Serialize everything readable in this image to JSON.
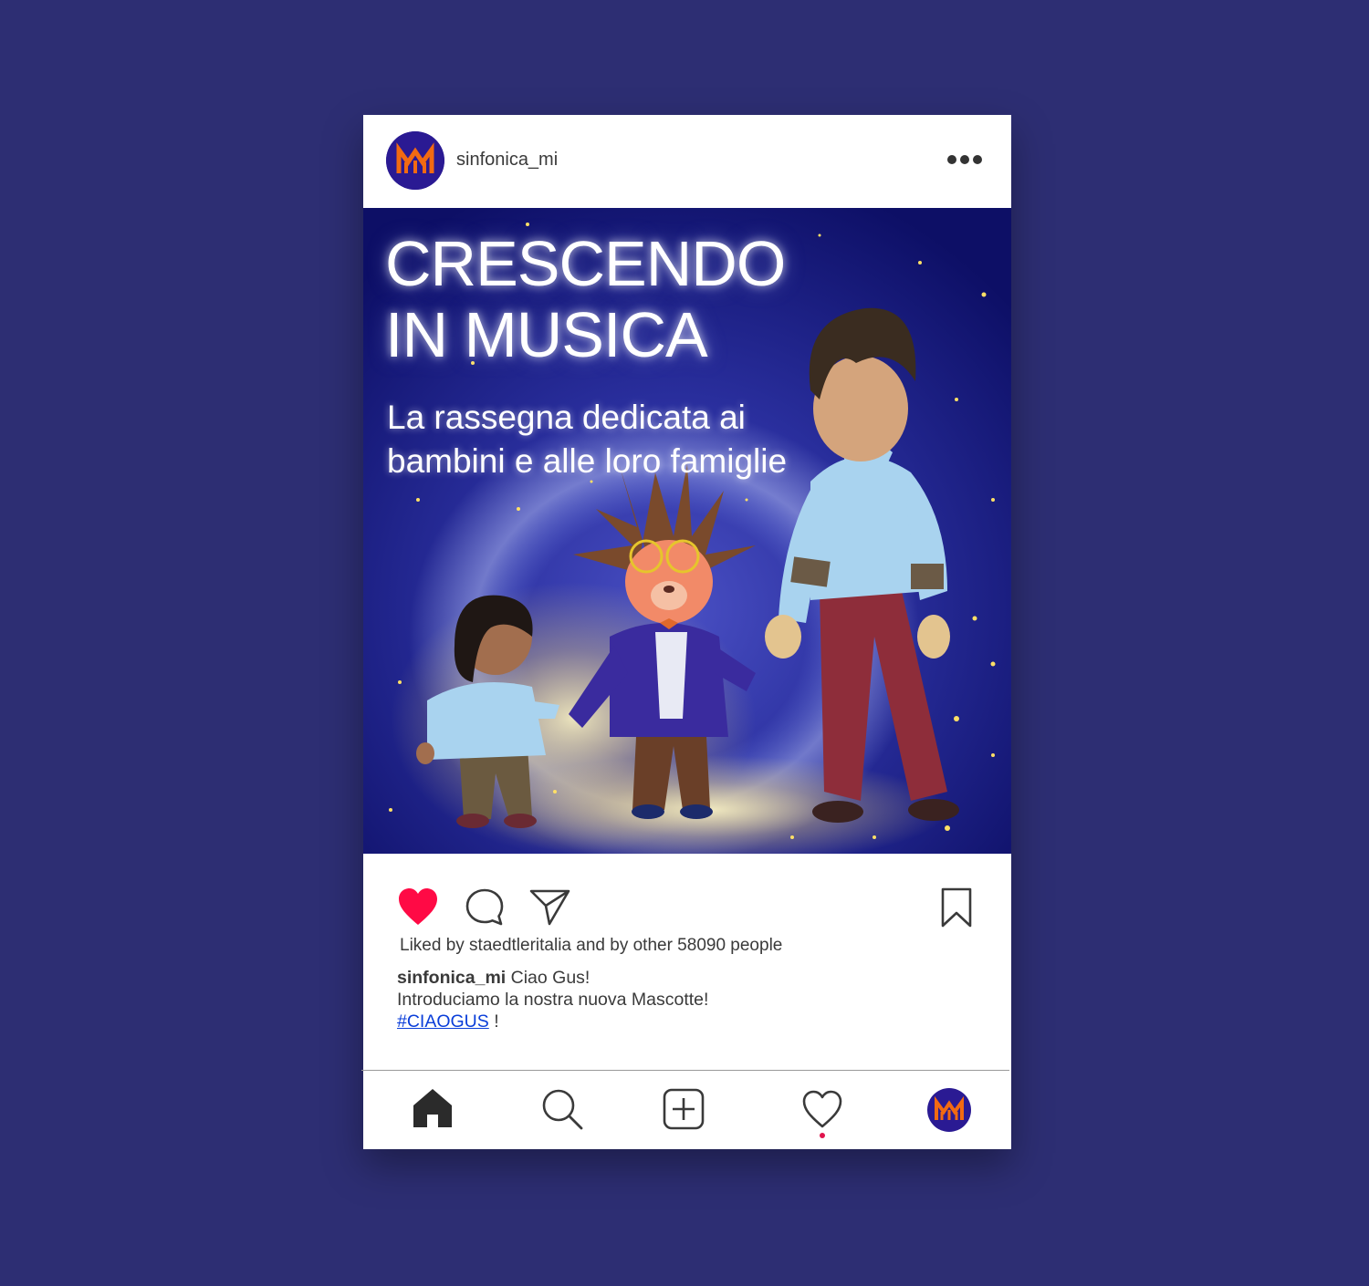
{
  "account": {
    "username": "sinfonica_mi",
    "logo_icon": "orchestra-monogram-icon",
    "logo_colors": {
      "background": "#2a1a93",
      "mark": "#f26a12"
    }
  },
  "post": {
    "headline_line1": "CRESCENDO",
    "headline_line2": "IN MUSICA",
    "subtitle_line1": "La rassegna dedicata ai",
    "subtitle_line2": "bambini e alle loro famiglie",
    "liked": true,
    "like_color": "#ff0a45",
    "likes_text": "Liked by staedtleritalia and by other 58090 people",
    "caption_username": "sinfonica_mi",
    "caption_line1": "Ciao Gus!",
    "caption_line2": "Introduciamo la nostra nuova Mascotte!",
    "hashtag": "#CIAOGUS",
    "caption_tail": " !"
  },
  "icons": {
    "more": "more-dots-icon",
    "like": "heart-filled-icon",
    "comment": "comment-bubble-icon",
    "share": "paper-plane-icon",
    "save": "bookmark-icon",
    "home": "home-icon",
    "search": "search-icon",
    "add": "add-post-icon",
    "activity": "heart-outline-icon",
    "profile": "profile-avatar-icon"
  },
  "nav": {
    "activity_has_notification": true,
    "notification_color": "#e0144c"
  }
}
